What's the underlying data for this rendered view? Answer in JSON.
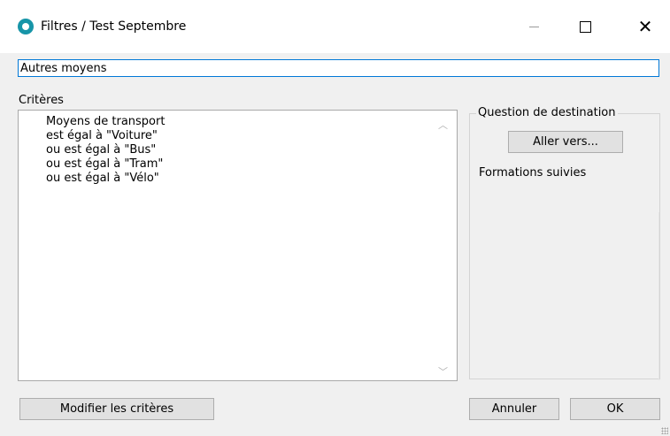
{
  "window": {
    "title": "Filtres / Test Septembre",
    "minimize_glyph": "—",
    "maximize_glyph": "□",
    "close_glyph": "✕"
  },
  "filter_name": {
    "value": "Autres moyens"
  },
  "criteria": {
    "label": "Critères",
    "text": "Moyens de transport\nest égal à \"Voiture\"\nou est égal à \"Bus\"\nou est égal à \"Tram\"\nou est égal à \"Vélo\"",
    "scroll_up": "︿",
    "scroll_down": "﹀"
  },
  "destination": {
    "legend": "Question de destination",
    "goto_label": "Aller vers...",
    "question": "Formations suivies"
  },
  "buttons": {
    "modify": "Modifier les critères",
    "cancel": "Annuler",
    "ok": "OK"
  },
  "colors": {
    "accent": "#0078d7",
    "app_icon": "#1795a8",
    "dialog_bg": "#f0f0f0"
  }
}
